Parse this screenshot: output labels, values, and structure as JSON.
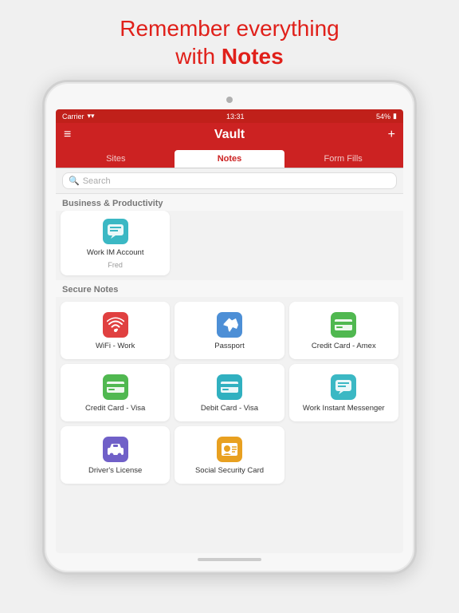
{
  "promo": {
    "line1": "Remember everything",
    "line2": "with ",
    "bold": "Notes"
  },
  "statusBar": {
    "carrier": "Carrier",
    "wifi": "📶",
    "time": "13:31",
    "battery": "54%"
  },
  "navBar": {
    "title": "Vault",
    "menuIcon": "≡",
    "addIcon": "+"
  },
  "tabs": [
    {
      "label": "Sites",
      "active": false
    },
    {
      "label": "Notes",
      "active": true
    },
    {
      "label": "Form Fills",
      "active": false
    }
  ],
  "search": {
    "placeholder": "Search"
  },
  "sections": [
    {
      "label": "Business & Productivity",
      "items": [
        {
          "name": "work-im-account",
          "icon": "msg",
          "iconColor": "teal",
          "label": "Work IM Account",
          "sublabel": "Fred",
          "hasNote": true
        }
      ]
    },
    {
      "label": "Secure Notes",
      "items": [
        {
          "name": "wifi-work",
          "icon": "wifi",
          "iconColor": "red",
          "label": "WiFi - Work",
          "sublabel": "",
          "hasNote": true
        },
        {
          "name": "passport",
          "icon": "plane",
          "iconColor": "blue",
          "label": "Passport",
          "sublabel": "",
          "hasNote": false
        },
        {
          "name": "credit-card-amex",
          "icon": "card",
          "iconColor": "green",
          "label": "Credit Card - Amex",
          "sublabel": "",
          "hasNote": false
        },
        {
          "name": "credit-card-visa",
          "icon": "card",
          "iconColor": "green",
          "label": "Credit Card - Visa",
          "sublabel": "",
          "hasNote": false
        },
        {
          "name": "debit-card-visa",
          "icon": "card",
          "iconColor": "teal",
          "label": "Debit Card - Visa",
          "sublabel": "",
          "hasNote": false
        },
        {
          "name": "work-instant-messenger",
          "icon": "msg",
          "iconColor": "teal",
          "label": "Work Instant Messenger",
          "sublabel": "",
          "hasNote": false
        },
        {
          "name": "drivers-license",
          "icon": "car",
          "iconColor": "purple",
          "label": "Driver's License",
          "sublabel": "",
          "hasNote": false
        },
        {
          "name": "social-security-card",
          "icon": "id",
          "iconColor": "amber",
          "label": "Social Security Card",
          "sublabel": "",
          "hasNote": false
        }
      ]
    }
  ]
}
